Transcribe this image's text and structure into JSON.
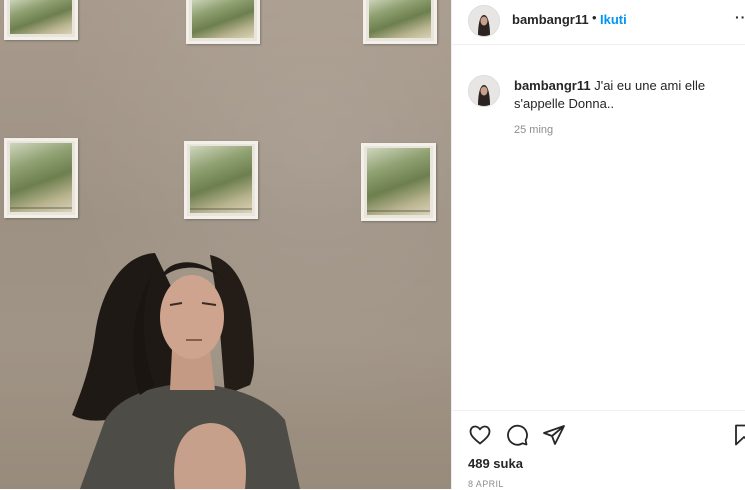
{
  "post": {
    "username": "bambangr11",
    "separator": "•",
    "follow_label": "Ikuti",
    "more_label": "··",
    "caption": "J'ai eu une ami elle s'appelle Donna..",
    "comment_time": "25 ming",
    "likes": "489 suka",
    "date": "8 APRIL"
  },
  "icons": {
    "like": "heart-icon",
    "comment": "comment-icon",
    "share": "share-icon",
    "save": "bookmark-icon"
  },
  "colors": {
    "follow": "#0095f6",
    "text": "#262626",
    "muted": "#8e8e8e"
  }
}
